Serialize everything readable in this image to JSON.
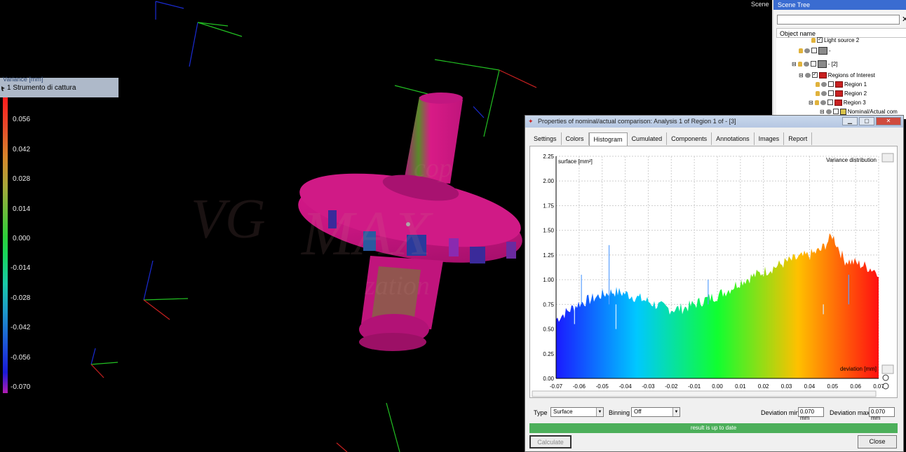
{
  "viewport": {
    "scene_label": "Scene",
    "watermark_lines": [
      "VG",
      "MAX",
      "cop",
      "zation"
    ]
  },
  "legend": {
    "title": "Variance [mm]",
    "capture_label": "1 Strumento di cattura",
    "ticks": [
      "0.056",
      "0.042",
      "0.028",
      "0.014",
      "0.000",
      "-0.014",
      "-0.028",
      "-0.042",
      "-0.056",
      "-0.070"
    ]
  },
  "scene_tree": {
    "title": "Scene Tree",
    "column_header": "Object name",
    "close_glyph": "✕",
    "items": [
      {
        "label": "Light source 2",
        "checked": true
      },
      {
        "label": "-",
        "checked": false
      },
      {
        "label": "- [2]",
        "checked": false
      },
      {
        "label": "Regions of Interest",
        "checked": true
      },
      {
        "label": "Region 1",
        "checked": false
      },
      {
        "label": "Region 2",
        "checked": false
      },
      {
        "label": "Region 3",
        "checked": false
      },
      {
        "label": "Nominal/Actual com",
        "checked": false
      }
    ]
  },
  "dialog": {
    "title": "Properties of nominal/actual comparison: Analysis 1 of Region 1 of - [3]",
    "tabs": [
      "Settings",
      "Colors",
      "Histogram",
      "Cumulated",
      "Components",
      "Annotations",
      "Images",
      "Report"
    ],
    "active_tab": "Histogram",
    "type_label": "Type",
    "type_value": "Surface",
    "binning_label": "Binning",
    "binning_value": "Off",
    "dev_min_label": "Deviation min:",
    "dev_min_value": "0.070 mm",
    "dev_max_label": "Deviation max:",
    "dev_max_value": "0.070 mm",
    "status": "result is up to date",
    "calculate_label": "Calculate",
    "close_label": "Close"
  },
  "chart_data": {
    "type": "area",
    "title": "Variance distribution",
    "xlabel": "deviation [mm]",
    "ylabel": "surface [mm²]",
    "xlim": [
      -0.07,
      0.07
    ],
    "ylim": [
      0,
      2.25
    ],
    "x_ticks": [
      "-0.07",
      "-0.06",
      "-0.05",
      "-0.04",
      "-0.03",
      "-0.02",
      "-0.01",
      "0.00",
      "0.01",
      "0.02",
      "0.03",
      "0.04",
      "0.05",
      "0.06",
      "0.07"
    ],
    "y_ticks": [
      "0.00",
      "0.25",
      "0.50",
      "0.75",
      "1.00",
      "1.25",
      "1.50",
      "1.75",
      "2.00",
      "2.25"
    ],
    "grid": true,
    "color_scale": [
      "#1a1aff",
      "#00c8ff",
      "#10ff30",
      "#ffc000",
      "#ff1010"
    ],
    "x": [
      -0.07,
      -0.065,
      -0.06,
      -0.055,
      -0.05,
      -0.045,
      -0.04,
      -0.035,
      -0.03,
      -0.025,
      -0.02,
      -0.015,
      -0.01,
      -0.005,
      0.0,
      0.005,
      0.01,
      0.015,
      0.02,
      0.025,
      0.03,
      0.035,
      0.04,
      0.045,
      0.05,
      0.055,
      0.06,
      0.065,
      0.07
    ],
    "values": [
      0.6,
      0.68,
      0.76,
      0.8,
      0.85,
      0.88,
      0.86,
      0.82,
      0.78,
      0.73,
      0.7,
      0.71,
      0.75,
      0.8,
      0.84,
      0.9,
      0.98,
      1.03,
      1.08,
      1.13,
      1.18,
      1.22,
      1.25,
      1.3,
      1.45,
      1.2,
      1.17,
      1.13,
      1.08
    ],
    "spikes": [
      {
        "x": -0.062,
        "value": 0.55
      },
      {
        "x": -0.059,
        "value": 1.05
      },
      {
        "x": -0.047,
        "value": 1.35
      },
      {
        "x": -0.044,
        "value": 0.5
      },
      {
        "x": -0.004,
        "value": 1.0
      },
      {
        "x": 0.046,
        "value": 0.65
      },
      {
        "x": 0.057,
        "value": 1.05
      }
    ]
  }
}
